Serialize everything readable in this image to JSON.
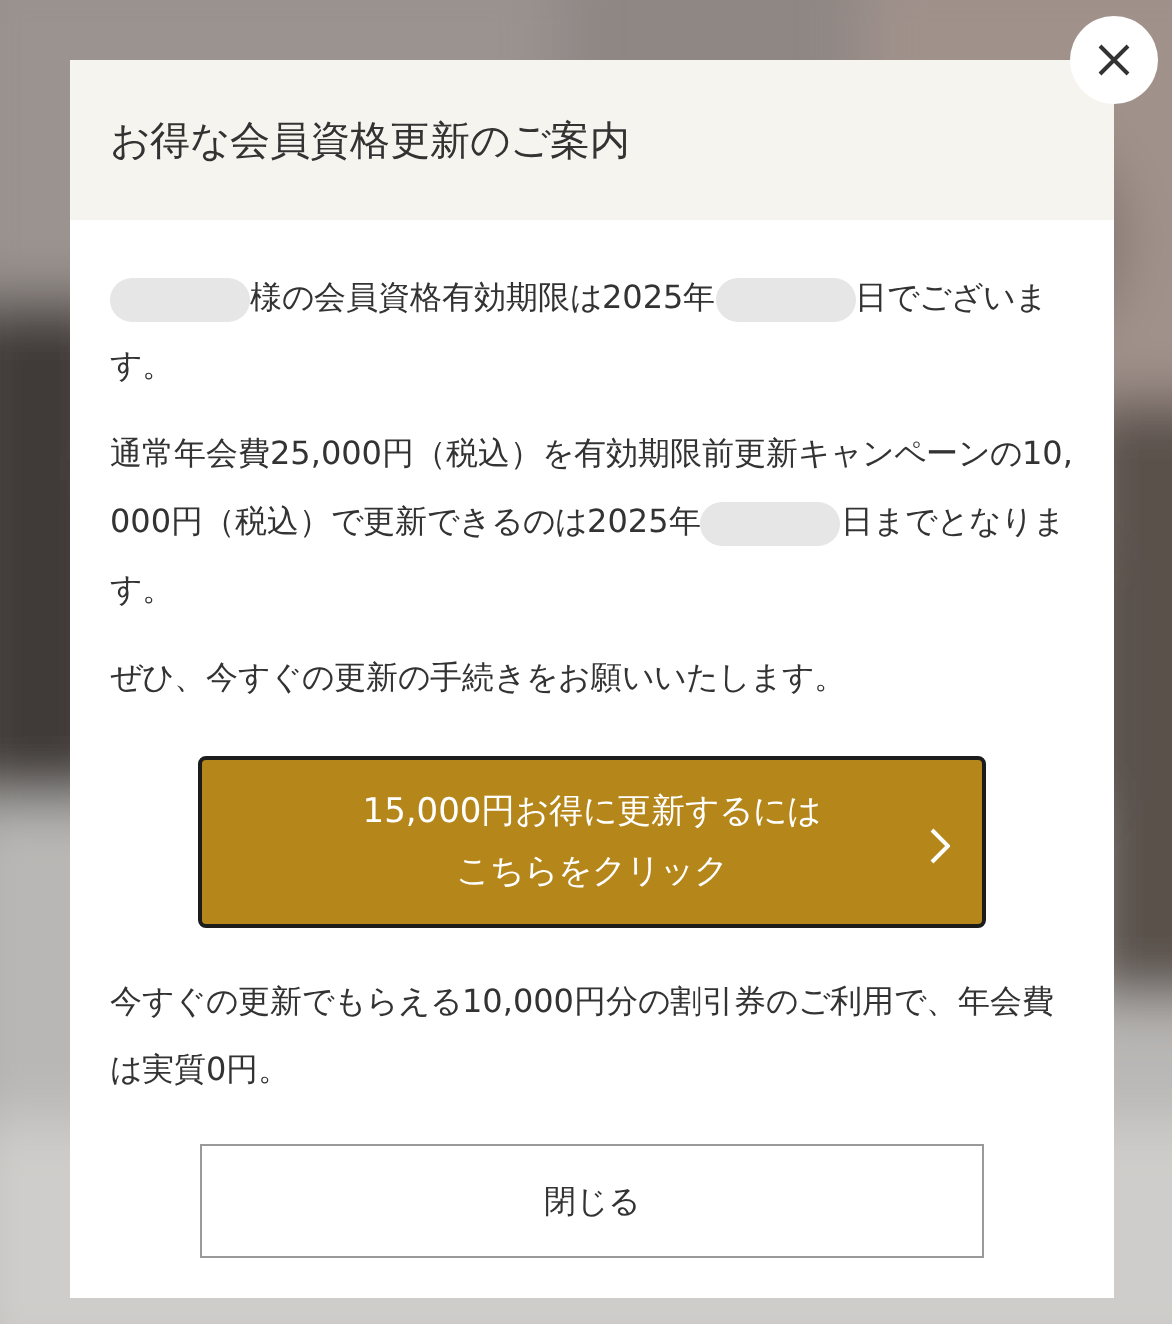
{
  "dialog": {
    "title": "お得な会員資格更新のご案内",
    "paragraphs": [
      {
        "segments": [
          {
            "kind": "redacted"
          },
          {
            "kind": "text",
            "text": "様の会員資格有効期限は2025年"
          },
          {
            "kind": "redacted"
          },
          {
            "kind": "text",
            "text": "日でございます。"
          }
        ]
      },
      {
        "segments": [
          {
            "kind": "text",
            "text": "通常年会費25,000円（税込）を有効期限前更新キャンペーンの10,000円（税込）で更新できるのは2025年"
          },
          {
            "kind": "redacted"
          },
          {
            "kind": "text",
            "text": "日までとなります。"
          }
        ]
      },
      {
        "segments": [
          {
            "kind": "text",
            "text": "ぜひ、今すぐの更新の手続きをお願いいたします。"
          }
        ]
      }
    ],
    "cta_button": {
      "lines": [
        "15,000円お得に更新するには",
        "こちらをクリック"
      ]
    },
    "note": "今すぐの更新でもらえる10,000円分の割引券のご利用で、年会費は実質0円。",
    "close_button": "閉じる"
  }
}
